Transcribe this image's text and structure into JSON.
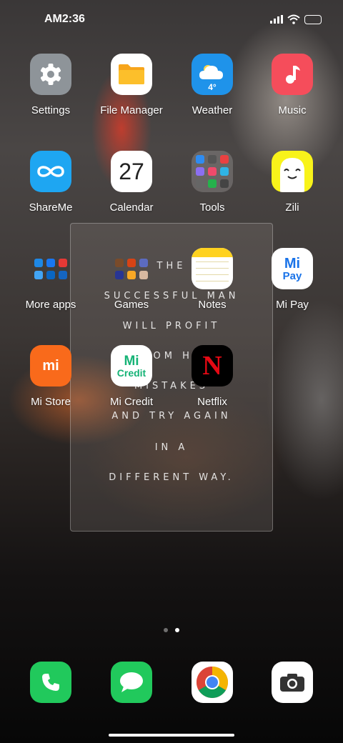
{
  "status_bar": {
    "time": "AM2:36"
  },
  "apps": {
    "settings": "Settings",
    "file_manager": "File Manager",
    "weather": "Weather",
    "weather_temp": "4°",
    "music": "Music",
    "shareme": "ShareMe",
    "calendar": "Calendar",
    "calendar_day": "27",
    "tools": "Tools",
    "zili": "Zili",
    "more_apps": "More apps",
    "games": "Games",
    "notes": "Notes",
    "mi_pay": "Mi Pay",
    "mi_pay_icon_top": "Mi",
    "mi_pay_icon_bottom": "Pay",
    "mi_store": "Mi Store",
    "mi_store_icon": "mi",
    "mi_credit": "Mi Credit",
    "mi_credit_icon_top": "Mi",
    "mi_credit_icon_bottom": "Credit",
    "netflix": "Netflix",
    "netflix_icon": "N"
  },
  "quote_widget": {
    "lines": [
      "THE",
      "SUCCESSFUL MAN",
      "WILL PROFIT",
      "FROM HIS",
      "MISTAKES",
      "AND TRY AGAIN",
      "IN A",
      "DIFFERENT WAY."
    ]
  },
  "page_indicator": {
    "count": 2,
    "active": 2
  },
  "dock": [
    "Phone",
    "Messages",
    "Chrome",
    "Camera"
  ],
  "icons": [
    "signal-icon",
    "wifi-icon",
    "battery-icon",
    "gear-icon",
    "folder-icon",
    "cloud-icon",
    "music-note-icon",
    "infinity-icon",
    "smiley-face-icon",
    "phone-icon",
    "chat-bubble-icon",
    "chrome-icon",
    "camera-icon"
  ],
  "colors": {
    "settings": "#8e9499",
    "file_manager": "#ffffff",
    "weather": "#1f93ea",
    "music": "#f54d5b",
    "shareme": "#1ea6f2",
    "zili": "#f8f31a",
    "mi_store": "#f96a1b",
    "mi_pay_text": "#1a73e8",
    "mi_credit": "#16b376",
    "netflix": "#e50914",
    "phone": "#21c95c",
    "messages": "#21c95c"
  }
}
